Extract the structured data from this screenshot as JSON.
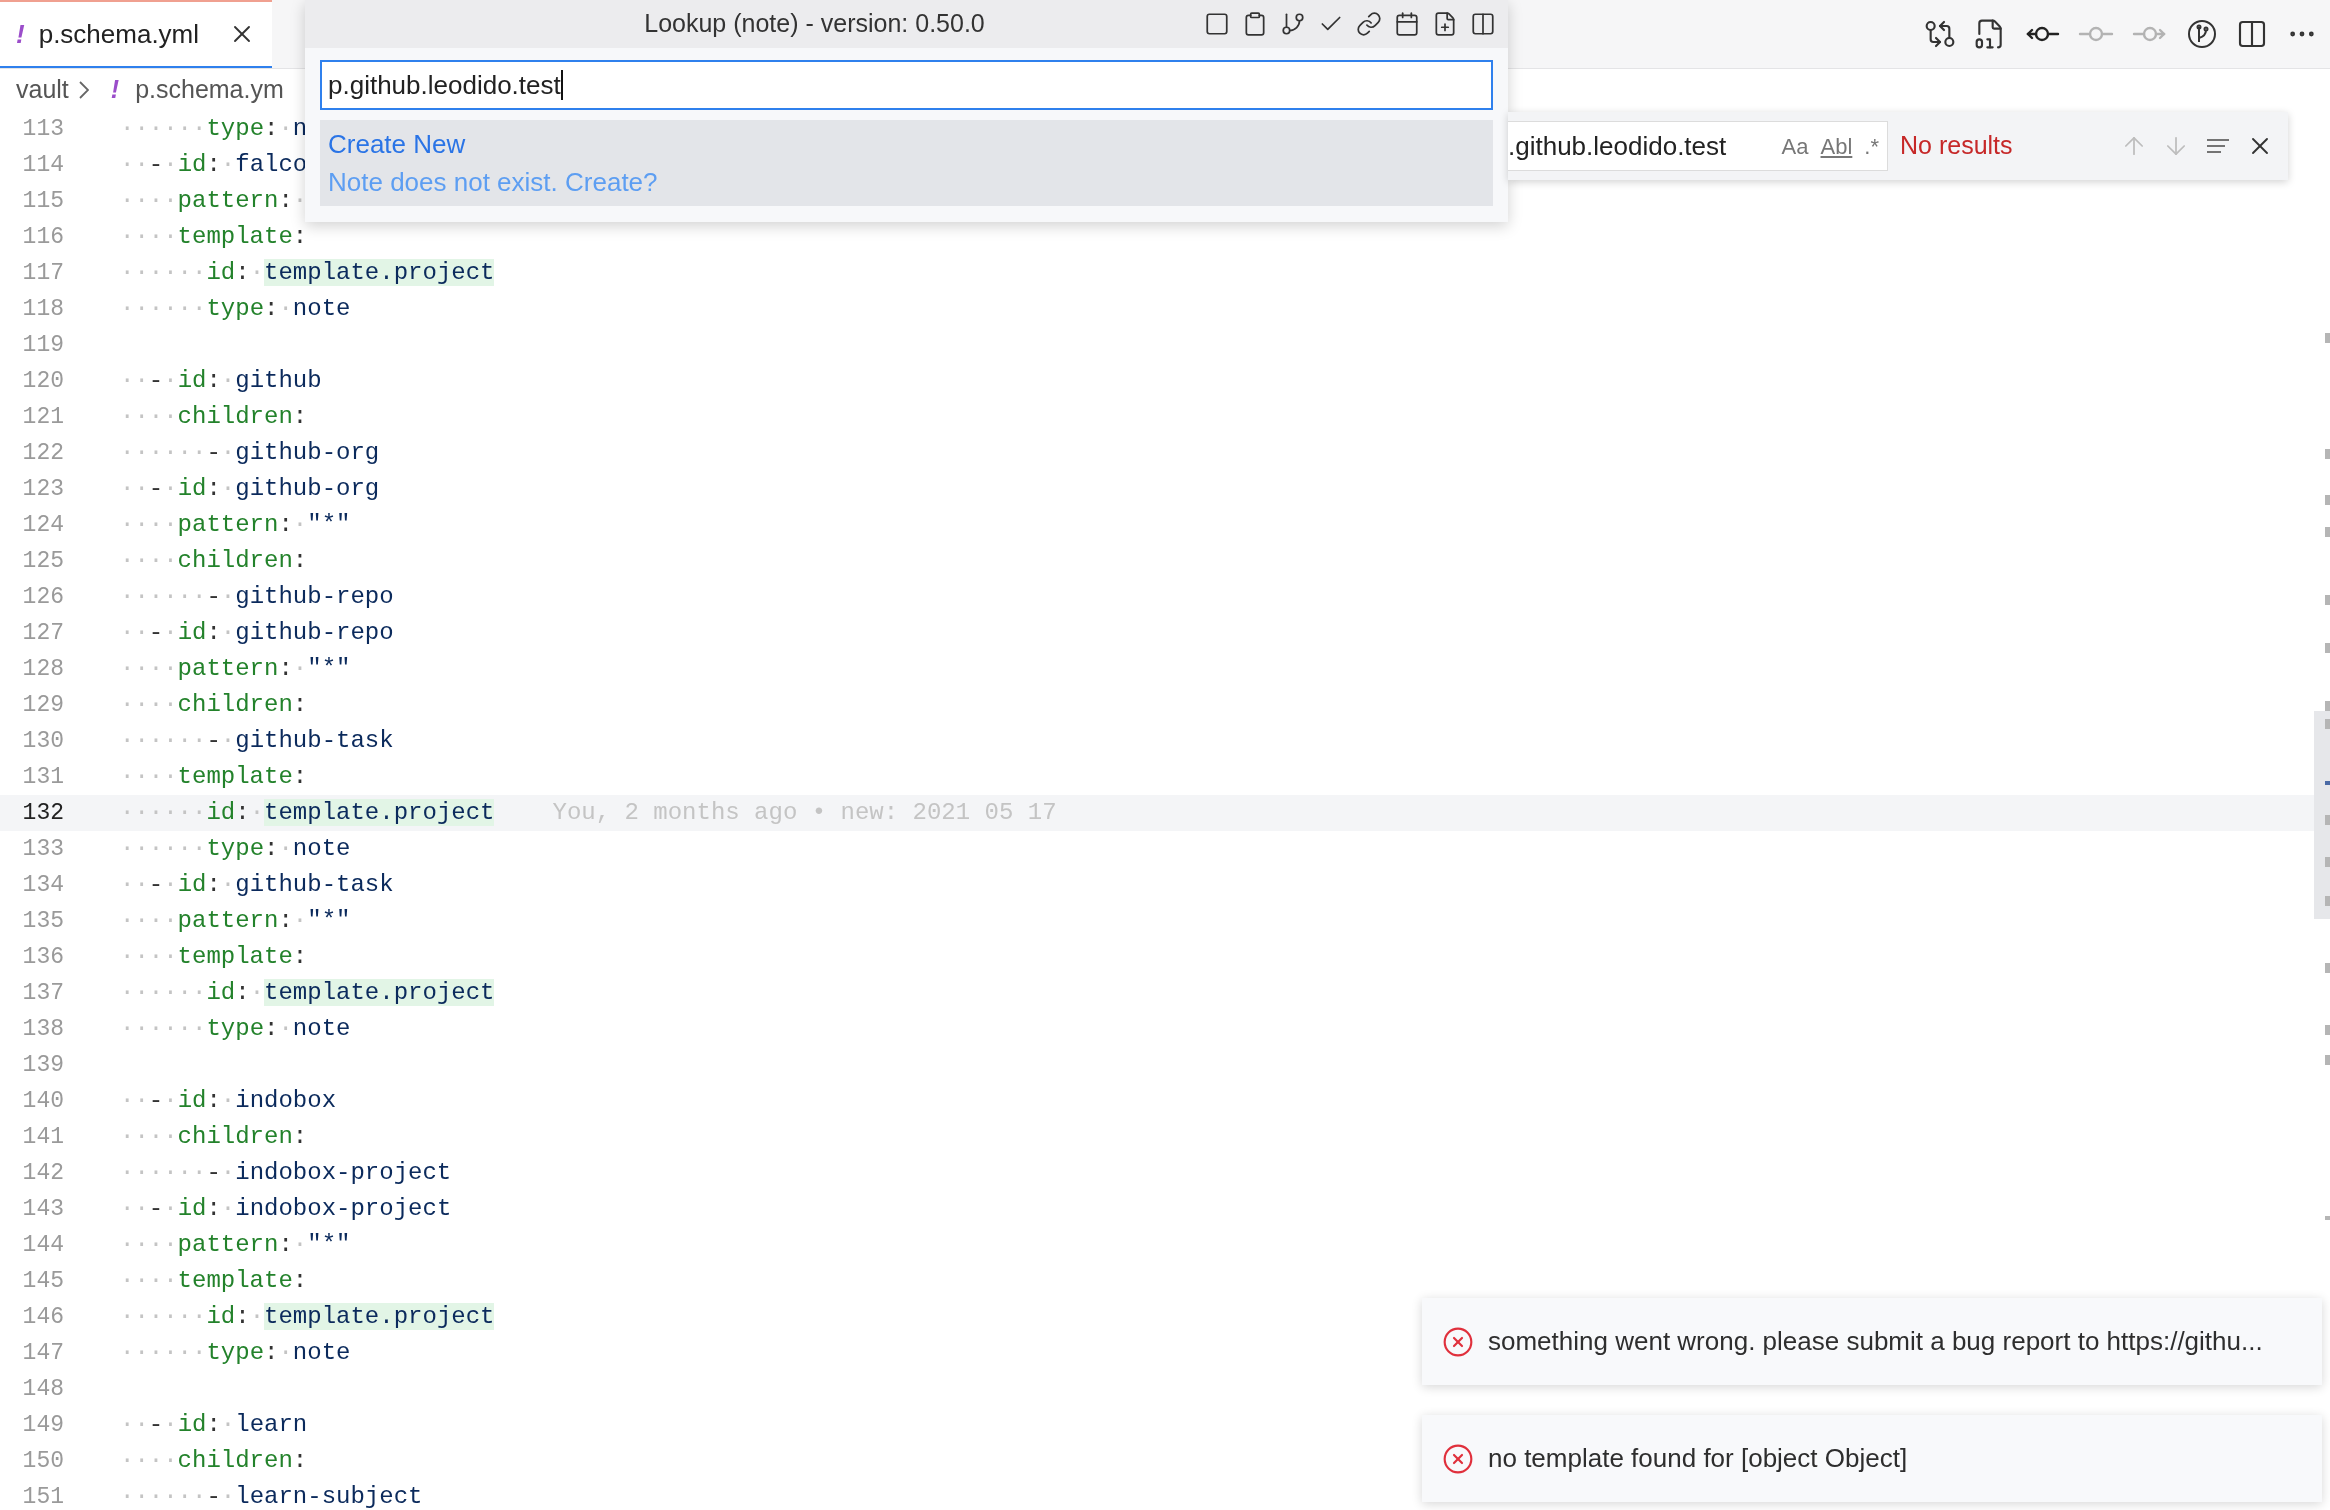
{
  "tab": {
    "icon": "!",
    "label": "p.schema.yml",
    "selected": true
  },
  "breadcrumb": [
    {
      "label": "vault"
    },
    {
      "icon": "!",
      "label": "p.schema.ym"
    }
  ],
  "lookup": {
    "title": "Lookup (note) - version: 0.50.0",
    "value": "p.github.leodido.test",
    "results": [
      {
        "label": "Create New",
        "detail": "Note does not exist. Create?",
        "selected": true
      }
    ]
  },
  "find": {
    "value": ".github.leodido.test",
    "options": [
      "Aa",
      "Abl",
      ".*"
    ],
    "status": "No results"
  },
  "lines": [
    {
      "number": "113",
      "current": false,
      "tokens": [
        {
          "kind": "space",
          "text": "······"
        },
        {
          "kind": "key",
          "text": "type"
        },
        {
          "kind": "punct",
          "text": ":"
        },
        {
          "kind": "space",
          "text": "·"
        },
        {
          "kind": "value",
          "text": "n"
        }
      ]
    },
    {
      "number": "114",
      "current": false,
      "tokens": [
        {
          "kind": "space",
          "text": "··"
        },
        {
          "kind": "punct",
          "text": "-"
        },
        {
          "kind": "space",
          "text": "·"
        },
        {
          "kind": "key",
          "text": "id"
        },
        {
          "kind": "punct",
          "text": ":"
        },
        {
          "kind": "space",
          "text": "·"
        },
        {
          "kind": "value",
          "text": "falco"
        }
      ]
    },
    {
      "number": "115",
      "current": false,
      "tokens": [
        {
          "kind": "space",
          "text": "····"
        },
        {
          "kind": "key",
          "text": "pattern"
        },
        {
          "kind": "punct",
          "text": ":"
        },
        {
          "kind": "space",
          "text": "·"
        }
      ]
    },
    {
      "number": "116",
      "current": false,
      "tokens": [
        {
          "kind": "space",
          "text": "····"
        },
        {
          "kind": "key",
          "text": "template"
        },
        {
          "kind": "punct",
          "text": ":"
        }
      ]
    },
    {
      "number": "117",
      "current": false,
      "tokens": [
        {
          "kind": "space",
          "text": "······"
        },
        {
          "kind": "key",
          "text": "id"
        },
        {
          "kind": "punct",
          "text": ":"
        },
        {
          "kind": "space",
          "text": "·"
        },
        {
          "kind": "match",
          "text": "template.project"
        }
      ]
    },
    {
      "number": "118",
      "current": false,
      "tokens": [
        {
          "kind": "space",
          "text": "······"
        },
        {
          "kind": "key",
          "text": "type"
        },
        {
          "kind": "punct",
          "text": ":"
        },
        {
          "kind": "space",
          "text": "·"
        },
        {
          "kind": "value",
          "text": "note"
        }
      ]
    },
    {
      "number": "119",
      "current": false
    },
    {
      "number": "120",
      "current": false,
      "tokens": [
        {
          "kind": "space",
          "text": "··"
        },
        {
          "kind": "punct",
          "text": "-"
        },
        {
          "kind": "space",
          "text": "·"
        },
        {
          "kind": "key",
          "text": "id"
        },
        {
          "kind": "punct",
          "text": ":"
        },
        {
          "kind": "space",
          "text": "·"
        },
        {
          "kind": "value",
          "text": "github"
        }
      ]
    },
    {
      "number": "121",
      "current": false,
      "tokens": [
        {
          "kind": "space",
          "text": "····"
        },
        {
          "kind": "key",
          "text": "children"
        },
        {
          "kind": "punct",
          "text": ":"
        }
      ]
    },
    {
      "number": "122",
      "current": false,
      "tokens": [
        {
          "kind": "space",
          "text": "······"
        },
        {
          "kind": "punct",
          "text": "-"
        },
        {
          "kind": "space",
          "text": "·"
        },
        {
          "kind": "value",
          "text": "github-org"
        }
      ]
    },
    {
      "number": "123",
      "current": false,
      "tokens": [
        {
          "kind": "space",
          "text": "··"
        },
        {
          "kind": "punct",
          "text": "-"
        },
        {
          "kind": "space",
          "text": "·"
        },
        {
          "kind": "key",
          "text": "id"
        },
        {
          "kind": "punct",
          "text": ":"
        },
        {
          "kind": "space",
          "text": "·"
        },
        {
          "kind": "value",
          "text": "github-org"
        }
      ]
    },
    {
      "number": "124",
      "current": false,
      "tokens": [
        {
          "kind": "space",
          "text": "····"
        },
        {
          "kind": "key",
          "text": "pattern"
        },
        {
          "kind": "punct",
          "text": ":"
        },
        {
          "kind": "space",
          "text": "·"
        },
        {
          "kind": "value",
          "text": "\"*\""
        }
      ]
    },
    {
      "number": "125",
      "current": false,
      "tokens": [
        {
          "kind": "space",
          "text": "····"
        },
        {
          "kind": "key",
          "text": "children"
        },
        {
          "kind": "punct",
          "text": ":"
        }
      ]
    },
    {
      "number": "126",
      "current": false,
      "tokens": [
        {
          "kind": "space",
          "text": "······"
        },
        {
          "kind": "punct",
          "text": "-"
        },
        {
          "kind": "space",
          "text": "·"
        },
        {
          "kind": "value",
          "text": "github-repo"
        }
      ]
    },
    {
      "number": "127",
      "current": false,
      "tokens": [
        {
          "kind": "space",
          "text": "··"
        },
        {
          "kind": "punct",
          "text": "-"
        },
        {
          "kind": "space",
          "text": "·"
        },
        {
          "kind": "key",
          "text": "id"
        },
        {
          "kind": "punct",
          "text": ":"
        },
        {
          "kind": "space",
          "text": "·"
        },
        {
          "kind": "value",
          "text": "github-repo"
        }
      ]
    },
    {
      "number": "128",
      "current": false,
      "tokens": [
        {
          "kind": "space",
          "text": "····"
        },
        {
          "kind": "key",
          "text": "pattern"
        },
        {
          "kind": "punct",
          "text": ":"
        },
        {
          "kind": "space",
          "text": "·"
        },
        {
          "kind": "value",
          "text": "\"*\""
        }
      ]
    },
    {
      "number": "129",
      "current": false,
      "tokens": [
        {
          "kind": "space",
          "text": "····"
        },
        {
          "kind": "key",
          "text": "children"
        },
        {
          "kind": "punct",
          "text": ":"
        }
      ]
    },
    {
      "number": "130",
      "current": false,
      "tokens": [
        {
          "kind": "space",
          "text": "······"
        },
        {
          "kind": "punct",
          "text": "-"
        },
        {
          "kind": "space",
          "text": "·"
        },
        {
          "kind": "value",
          "text": "github-task"
        }
      ]
    },
    {
      "number": "131",
      "current": false,
      "tokens": [
        {
          "kind": "space",
          "text": "····"
        },
        {
          "kind": "key",
          "text": "template"
        },
        {
          "kind": "punct",
          "text": ":"
        }
      ]
    },
    {
      "number": "132",
      "current": true,
      "tokens": [
        {
          "kind": "space",
          "text": "······"
        },
        {
          "kind": "key",
          "text": "id"
        },
        {
          "kind": "punct",
          "text": ":"
        },
        {
          "kind": "space",
          "text": "·"
        },
        {
          "kind": "match",
          "text": "template.project"
        }
      ],
      "blame": "You, 2 months ago • new: 2021 05 17"
    },
    {
      "number": "133",
      "current": false,
      "tokens": [
        {
          "kind": "space",
          "text": "······"
        },
        {
          "kind": "key",
          "text": "type"
        },
        {
          "kind": "punct",
          "text": ":"
        },
        {
          "kind": "space",
          "text": "·"
        },
        {
          "kind": "value",
          "text": "note"
        }
      ]
    },
    {
      "number": "134",
      "current": false,
      "tokens": [
        {
          "kind": "space",
          "text": "··"
        },
        {
          "kind": "punct",
          "text": "-"
        },
        {
          "kind": "space",
          "text": "·"
        },
        {
          "kind": "key",
          "text": "id"
        },
        {
          "kind": "punct",
          "text": ":"
        },
        {
          "kind": "space",
          "text": "·"
        },
        {
          "kind": "value",
          "text": "github-task"
        }
      ]
    },
    {
      "number": "135",
      "current": false,
      "tokens": [
        {
          "kind": "space",
          "text": "····"
        },
        {
          "kind": "key",
          "text": "pattern"
        },
        {
          "kind": "punct",
          "text": ":"
        },
        {
          "kind": "space",
          "text": "·"
        },
        {
          "kind": "value",
          "text": "\"*\""
        }
      ]
    },
    {
      "number": "136",
      "current": false,
      "tokens": [
        {
          "kind": "space",
          "text": "····"
        },
        {
          "kind": "key",
          "text": "template"
        },
        {
          "kind": "punct",
          "text": ":"
        }
      ]
    },
    {
      "number": "137",
      "current": false,
      "tokens": [
        {
          "kind": "space",
          "text": "······"
        },
        {
          "kind": "key",
          "text": "id"
        },
        {
          "kind": "punct",
          "text": ":"
        },
        {
          "kind": "space",
          "text": "·"
        },
        {
          "kind": "match",
          "text": "template.project"
        }
      ]
    },
    {
      "number": "138",
      "current": false,
      "tokens": [
        {
          "kind": "space",
          "text": "······"
        },
        {
          "kind": "key",
          "text": "type"
        },
        {
          "kind": "punct",
          "text": ":"
        },
        {
          "kind": "space",
          "text": "·"
        },
        {
          "kind": "value",
          "text": "note"
        }
      ]
    },
    {
      "number": "139",
      "current": false
    },
    {
      "number": "140",
      "current": false,
      "tokens": [
        {
          "kind": "space",
          "text": "··"
        },
        {
          "kind": "punct",
          "text": "-"
        },
        {
          "kind": "space",
          "text": "·"
        },
        {
          "kind": "key",
          "text": "id"
        },
        {
          "kind": "punct",
          "text": ":"
        },
        {
          "kind": "space",
          "text": "·"
        },
        {
          "kind": "value",
          "text": "indobox"
        }
      ]
    },
    {
      "number": "141",
      "current": false,
      "tokens": [
        {
          "kind": "space",
          "text": "····"
        },
        {
          "kind": "key",
          "text": "children"
        },
        {
          "kind": "punct",
          "text": ":"
        }
      ]
    },
    {
      "number": "142",
      "current": false,
      "tokens": [
        {
          "kind": "space",
          "text": "······"
        },
        {
          "kind": "punct",
          "text": "-"
        },
        {
          "kind": "space",
          "text": "·"
        },
        {
          "kind": "value",
          "text": "indobox-project"
        }
      ]
    },
    {
      "number": "143",
      "current": false,
      "tokens": [
        {
          "kind": "space",
          "text": "··"
        },
        {
          "kind": "punct",
          "text": "-"
        },
        {
          "kind": "space",
          "text": "·"
        },
        {
          "kind": "key",
          "text": "id"
        },
        {
          "kind": "punct",
          "text": ":"
        },
        {
          "kind": "space",
          "text": "·"
        },
        {
          "kind": "value",
          "text": "indobox-project"
        }
      ]
    },
    {
      "number": "144",
      "current": false,
      "tokens": [
        {
          "kind": "space",
          "text": "····"
        },
        {
          "kind": "key",
          "text": "pattern"
        },
        {
          "kind": "punct",
          "text": ":"
        },
        {
          "kind": "space",
          "text": "·"
        },
        {
          "kind": "value",
          "text": "\"*\""
        }
      ]
    },
    {
      "number": "145",
      "current": false,
      "tokens": [
        {
          "kind": "space",
          "text": "····"
        },
        {
          "kind": "key",
          "text": "template"
        },
        {
          "kind": "punct",
          "text": ":"
        }
      ]
    },
    {
      "number": "146",
      "current": false,
      "tokens": [
        {
          "kind": "space",
          "text": "······"
        },
        {
          "kind": "key",
          "text": "id"
        },
        {
          "kind": "punct",
          "text": ":"
        },
        {
          "kind": "space",
          "text": "·"
        },
        {
          "kind": "match",
          "text": "template.project"
        }
      ]
    },
    {
      "number": "147",
      "current": false,
      "tokens": [
        {
          "kind": "space",
          "text": "······"
        },
        {
          "kind": "key",
          "text": "type"
        },
        {
          "kind": "punct",
          "text": ":"
        },
        {
          "kind": "space",
          "text": "·"
        },
        {
          "kind": "value",
          "text": "note"
        }
      ]
    },
    {
      "number": "148",
      "current": false
    },
    {
      "number": "149",
      "current": false,
      "tokens": [
        {
          "kind": "space",
          "text": "··"
        },
        {
          "kind": "punct",
          "text": "-"
        },
        {
          "kind": "space",
          "text": "·"
        },
        {
          "kind": "key",
          "text": "id"
        },
        {
          "kind": "punct",
          "text": ":"
        },
        {
          "kind": "space",
          "text": "·"
        },
        {
          "kind": "value",
          "text": "learn"
        }
      ]
    },
    {
      "number": "150",
      "current": false,
      "tokens": [
        {
          "kind": "space",
          "text": "····"
        },
        {
          "kind": "key",
          "text": "children"
        },
        {
          "kind": "punct",
          "text": ":"
        }
      ]
    },
    {
      "number": "151",
      "current": false,
      "tokens": [
        {
          "kind": "space",
          "text": "······"
        },
        {
          "kind": "punct",
          "text": "-"
        },
        {
          "kind": "space",
          "text": "·"
        },
        {
          "kind": "value",
          "text": "learn-subject"
        }
      ]
    }
  ],
  "notifications": [
    {
      "kind": "error",
      "message": "something went wrong. please submit a bug report to https://githu..."
    },
    {
      "kind": "error",
      "message": "no template found for [object Object]"
    }
  ]
}
